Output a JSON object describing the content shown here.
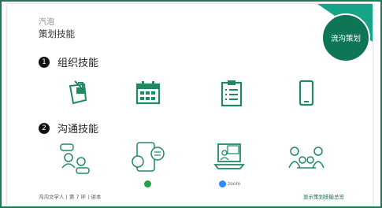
{
  "slide": {
    "supertitle": "汽泡",
    "title": "策划技能",
    "badge": "流沟策划"
  },
  "sections": [
    {
      "number": "1",
      "title": "组织技能"
    },
    {
      "number": "2",
      "title": "沟通技能"
    }
  ],
  "org_icons": [
    "sticky-note-icon",
    "calendar-icon",
    "clipboard-checklist-icon",
    "smartphone-icon"
  ],
  "comm_icons": [
    "chat-people-icon",
    "phone-chat-icon",
    "video-call-laptop-icon",
    "team-meeting-icon"
  ],
  "app_logos": {
    "whatsapp": "whatsapp-logo-icon",
    "zoom_label": "zoom"
  },
  "footer": {
    "left": "沟沟文学人 | 第 7 环 | 讲本",
    "right": "显示策划技能总览"
  },
  "colors": {
    "accent": "#0e7556",
    "corner": "#17a386",
    "icon": "#1f8a5f"
  }
}
